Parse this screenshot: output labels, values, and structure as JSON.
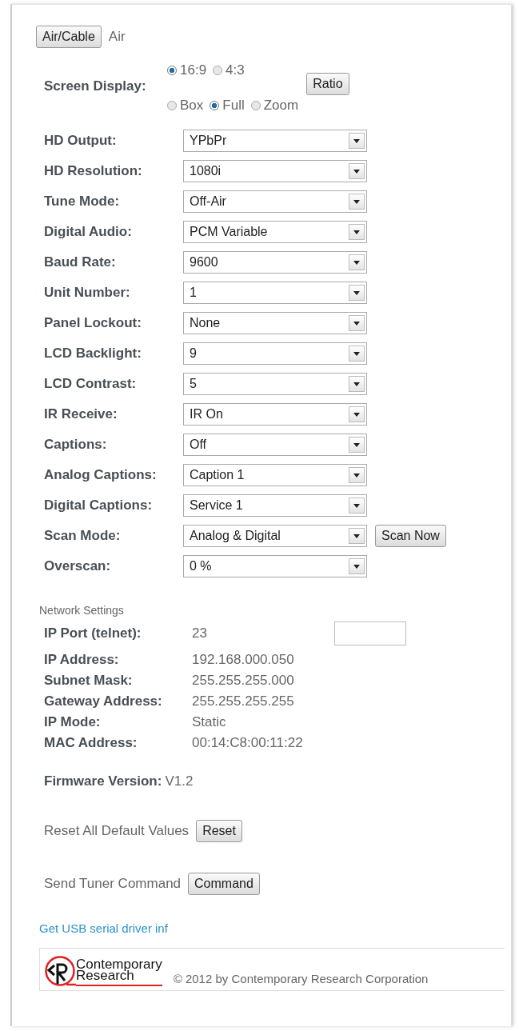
{
  "air_cable": {
    "button": "Air/Cable",
    "value": "Air"
  },
  "screen_display": {
    "label": "Screen Display:",
    "aspect_options": [
      {
        "label": "16:9",
        "selected": true
      },
      {
        "label": "4:3",
        "selected": false
      }
    ],
    "mode_options": [
      {
        "label": "Box",
        "selected": false
      },
      {
        "label": "Full",
        "selected": true
      },
      {
        "label": "Zoom",
        "selected": false
      }
    ],
    "button": "Ratio"
  },
  "settings": [
    {
      "label": "HD Output:",
      "value": "YPbPr"
    },
    {
      "label": "HD Resolution:",
      "value": "1080i"
    },
    {
      "label": "Tune Mode:",
      "value": "Off-Air"
    },
    {
      "label": "Digital Audio:",
      "value": "PCM Variable"
    },
    {
      "label": "Baud Rate:",
      "value": "9600"
    },
    {
      "label": "Unit Number:",
      "value": "1"
    },
    {
      "label": "Panel Lockout:",
      "value": "None"
    },
    {
      "label": "LCD Backlight:",
      "value": "9"
    },
    {
      "label": "LCD Contrast:",
      "value": "5"
    },
    {
      "label": "IR Receive:",
      "value": "IR On"
    },
    {
      "label": "Captions:",
      "value": "Off"
    },
    {
      "label": "Analog Captions:",
      "value": "Caption 1"
    },
    {
      "label": "Digital Captions:",
      "value": "Service 1"
    },
    {
      "label": "Scan Mode:",
      "value": "Analog & Digital",
      "button": "Scan Now"
    },
    {
      "label": "Overscan:",
      "value": "0 %"
    }
  ],
  "network": {
    "heading": "Network Settings",
    "port": {
      "label": "IP Port (telnet):",
      "value": "23"
    },
    "rows": [
      {
        "label": "IP Address:",
        "value": "192.168.000.050"
      },
      {
        "label": "Subnet Mask:",
        "value": "255.255.255.000"
      },
      {
        "label": "Gateway Address:",
        "value": "255.255.255.255"
      },
      {
        "label": "IP Mode:",
        "value": "Static"
      },
      {
        "label": "MAC Address:",
        "value": "00:14:C8:00:11:22"
      }
    ]
  },
  "firmware": {
    "label": "Firmware Version:",
    "value": "V1.2"
  },
  "reset": {
    "label": "Reset All Default Values",
    "button": "Reset"
  },
  "command": {
    "label": "Send Tuner Command",
    "button": "Command"
  },
  "link": "Get USB serial driver inf",
  "footer": {
    "logo_lines": [
      "Contemporary",
      "Research"
    ],
    "copyright": "© 2012 by Contemporary Research Corporation"
  }
}
